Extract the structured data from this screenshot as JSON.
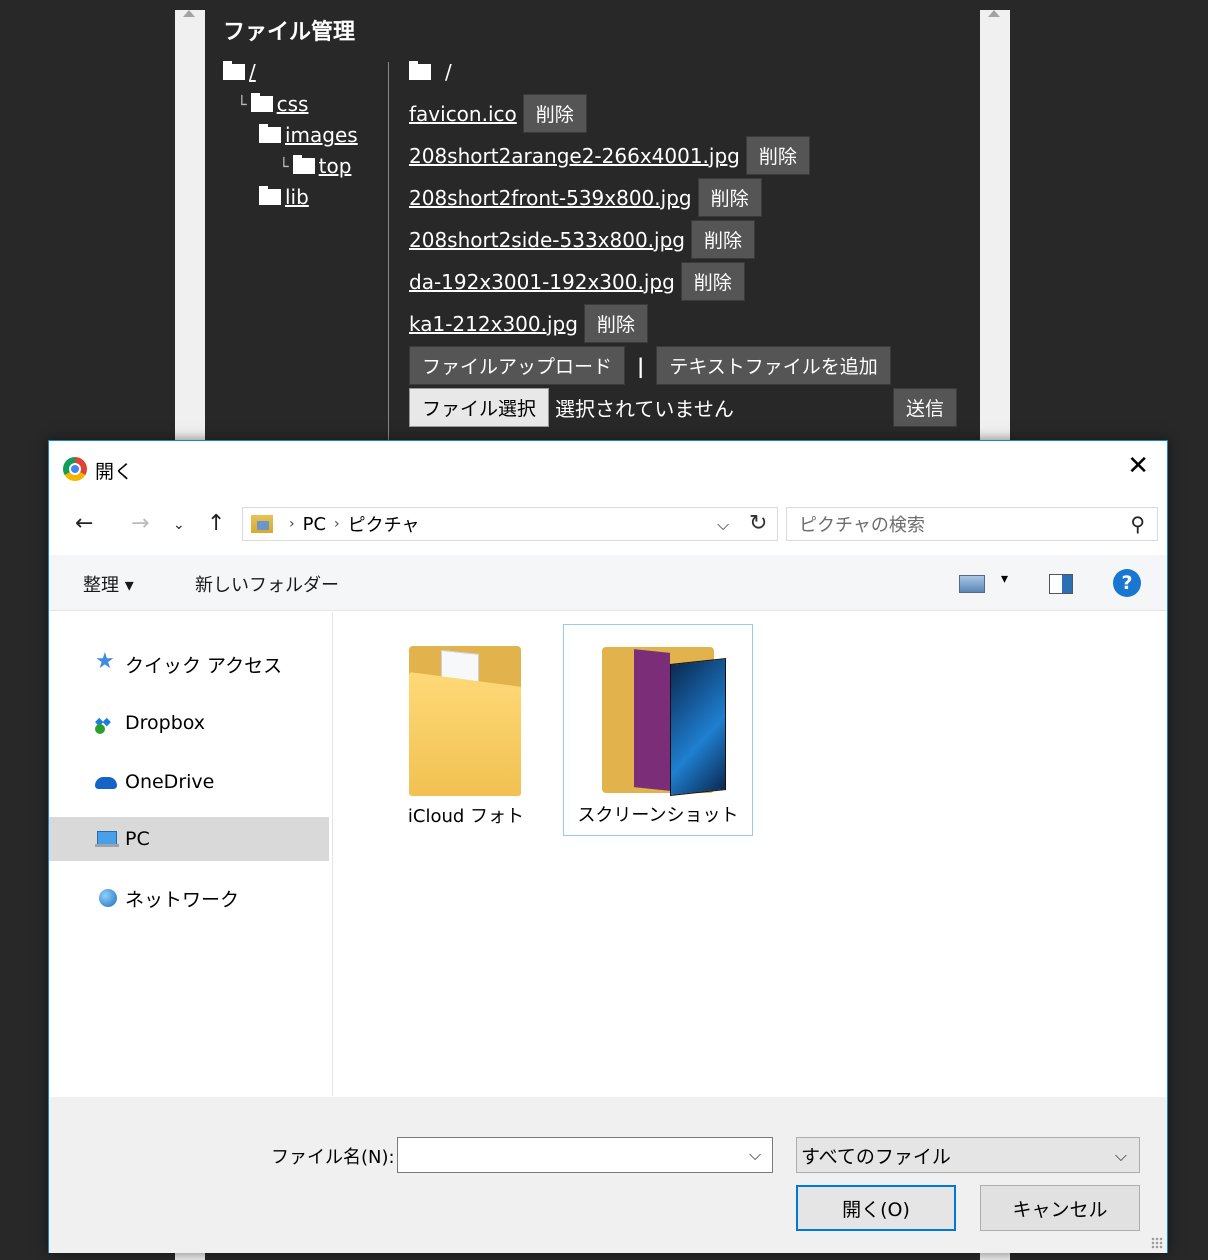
{
  "page": {
    "title": "ファイル管理",
    "tree": [
      {
        "label": "/"
      },
      {
        "label": "css"
      },
      {
        "label": "images"
      },
      {
        "label": "top"
      },
      {
        "label": "lib"
      }
    ],
    "current_path": "/",
    "files": [
      {
        "name": "favicon.ico"
      },
      {
        "name": "208short2arange2-266x4001.jpg"
      },
      {
        "name": "208short2front-539x800.jpg"
      },
      {
        "name": "208short2side-533x800.jpg"
      },
      {
        "name": "da-192x3001-192x300.jpg"
      },
      {
        "name": "ka1-212x300.jpg"
      }
    ],
    "delete_label": "削除",
    "upload_label": "ファイルアップロード",
    "separator": "|",
    "add_text_label": "テキストファイルを追加",
    "choose_file_label": "ファイル選択",
    "no_file_label": "選択されていません",
    "submit_label": "送信"
  },
  "dialog": {
    "title": "開く",
    "breadcrumb": [
      "PC",
      "ピクチャ"
    ],
    "search_placeholder": "ピクチャの検索",
    "organize_label": "整理 ▾",
    "new_folder_label": "新しいフォルダー",
    "help_label": "?",
    "sidebar": [
      {
        "label": "クイック アクセス",
        "icon": "star-icon"
      },
      {
        "label": "Dropbox",
        "icon": "dropbox-icon"
      },
      {
        "label": "OneDrive",
        "icon": "onedrive-icon"
      },
      {
        "label": "PC",
        "icon": "pc-icon",
        "selected": true
      },
      {
        "label": "ネットワーク",
        "icon": "network-icon"
      }
    ],
    "folders": [
      {
        "label": "iCloud フォト"
      },
      {
        "label": "スクリーンショット",
        "selected": true
      }
    ],
    "filename_label": "ファイル名(N):",
    "filename_value": "",
    "filetype_value": "すべてのファイル",
    "open_label": "開く(O)",
    "cancel_label": "キャンセル"
  },
  "colors": {
    "page_bg": "#282828",
    "accent": "#0078d7",
    "selected_bg": "#d9d9d9"
  }
}
